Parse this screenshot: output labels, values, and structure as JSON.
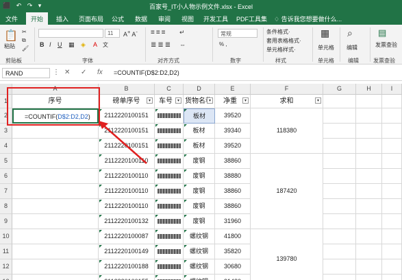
{
  "window": {
    "title": "百家号_IT小人物示例文件.xlsx - Excel",
    "quick_access": "⬛ ↶ ↷ ▾"
  },
  "tabs": [
    "文件",
    "开始",
    "插入",
    "页面布局",
    "公式",
    "数据",
    "审阅",
    "视图",
    "开发工具",
    "PDF工具集"
  ],
  "active_tab": "开始",
  "tell_me": "告诉我您想要做什么...",
  "ribbon": {
    "paste": "粘贴",
    "group_labels": [
      "剪贴板",
      "字体",
      "对齐方式",
      "数字",
      "样式",
      "单元格",
      "编辑",
      "发票查验"
    ],
    "font_size": "11",
    "number_format": "常规",
    "styles": [
      "条件格式·",
      "套用表格格式·",
      "单元格样式·"
    ],
    "cells_btn": "单元格",
    "edit_btn": "编辑",
    "invoice": "发票查验",
    "currency": "% ,"
  },
  "formula_bar": {
    "name_box": "RAND",
    "cancel": "✕",
    "confirm": "✓",
    "fx": "fx",
    "formula": "=COUNTIF(D$2:D2,D2)"
  },
  "columns": [
    "A",
    "B",
    "C",
    "D",
    "E",
    "F",
    "G",
    "H",
    "I"
  ],
  "rows": [
    "1",
    "2",
    "3",
    "4",
    "5",
    "6",
    "7",
    "8",
    "9",
    "10",
    "11",
    "12",
    "13"
  ],
  "headers": {
    "a": "序号",
    "b": "磅单序号",
    "c": "车号",
    "d": "货物名称",
    "e": "净重",
    "f": "求和"
  },
  "edit_cell": {
    "prefix": "=COUNTIF(",
    "ref": "D$2:D2,D2",
    "suffix": ")"
  },
  "table": [
    {
      "b": "2112220100151",
      "d": "板材",
      "e": "39520"
    },
    {
      "b": "2112220100151",
      "d": "板材",
      "e": "39340"
    },
    {
      "b": "2112220100151",
      "d": "板材",
      "e": "39520"
    },
    {
      "b": "2112220100110",
      "d": "废钢",
      "e": "38860"
    },
    {
      "b": "2112220100110",
      "d": "废钢",
      "e": "38880"
    },
    {
      "b": "2112220100110",
      "d": "废钢",
      "e": "38860"
    },
    {
      "b": "2112220100110",
      "d": "废钢",
      "e": "38860"
    },
    {
      "b": "2112220100132",
      "d": "废钢",
      "e": "31960"
    },
    {
      "b": "2112220100087",
      "d": "螺纹钢",
      "e": "41800"
    },
    {
      "b": "2112220100149",
      "d": "螺纹钢",
      "e": "35820"
    },
    {
      "b": "2112220100188",
      "d": "螺纹钢",
      "e": "30680"
    },
    {
      "b": "2112220100155",
      "d": "螺纹钢",
      "e": "31480"
    }
  ],
  "sums": [
    "118380",
    "187420",
    "139780"
  ],
  "colors": {
    "excel_green": "#217346",
    "highlight_red": "#e02020",
    "ref_blue": "#1f5fbf",
    "selected_cell": "#dce6f5"
  }
}
